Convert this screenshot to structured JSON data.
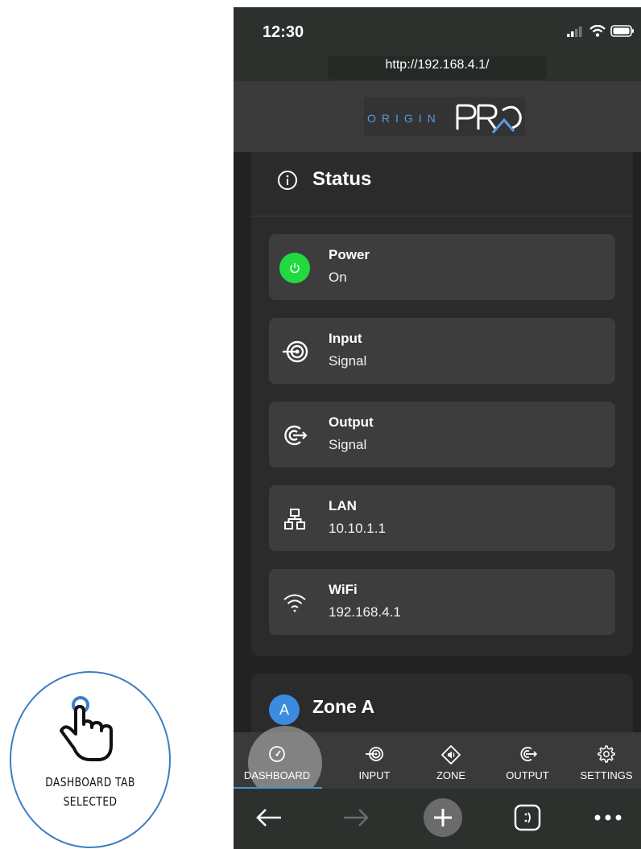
{
  "annotation": {
    "line1": "DASHBOARD TAB",
    "line2": "SELECTED",
    "icon": "pointing-hand-icon"
  },
  "phone": {
    "status_bar": {
      "time": "12:30",
      "icons": [
        "signal-icon",
        "wifi-icon",
        "battery-icon"
      ]
    },
    "browser": {
      "url": "http://192.168.4.1/"
    },
    "header": {
      "logo_text": "ORIGIN",
      "logo_mark": "PRO"
    },
    "status": {
      "title": "Status",
      "icon": "info-icon",
      "items": [
        {
          "title": "Power",
          "value": "On",
          "icon": "power-icon",
          "color": "#22d940"
        },
        {
          "title": "Input",
          "value": "Signal",
          "icon": "input-icon"
        },
        {
          "title": "Output",
          "value": "Signal",
          "icon": "output-icon"
        },
        {
          "title": "LAN",
          "value": "10.10.1.1",
          "icon": "network-icon"
        },
        {
          "title": "WiFi",
          "value": "192.168.4.1",
          "icon": "wifi-icon"
        }
      ]
    },
    "zone": {
      "badge": "A",
      "title": "Zone A",
      "badge_color": "#3b8ce0"
    },
    "tabs": [
      {
        "label": "DASHBOARD",
        "icon": "gauge-icon",
        "selected": true
      },
      {
        "label": "INPUT",
        "icon": "input-icon"
      },
      {
        "label": "ZONE",
        "icon": "speaker-diamond-icon"
      },
      {
        "label": "OUTPUT",
        "icon": "output-icon"
      },
      {
        "label": "SETTINGS",
        "icon": "gear-icon"
      }
    ],
    "browser_toolbar": [
      "back-arrow-icon",
      "forward-arrow-icon",
      "new-tab-icon",
      "tabs-icon",
      "more-icon"
    ],
    "accent_color": "#4f8fd8"
  }
}
